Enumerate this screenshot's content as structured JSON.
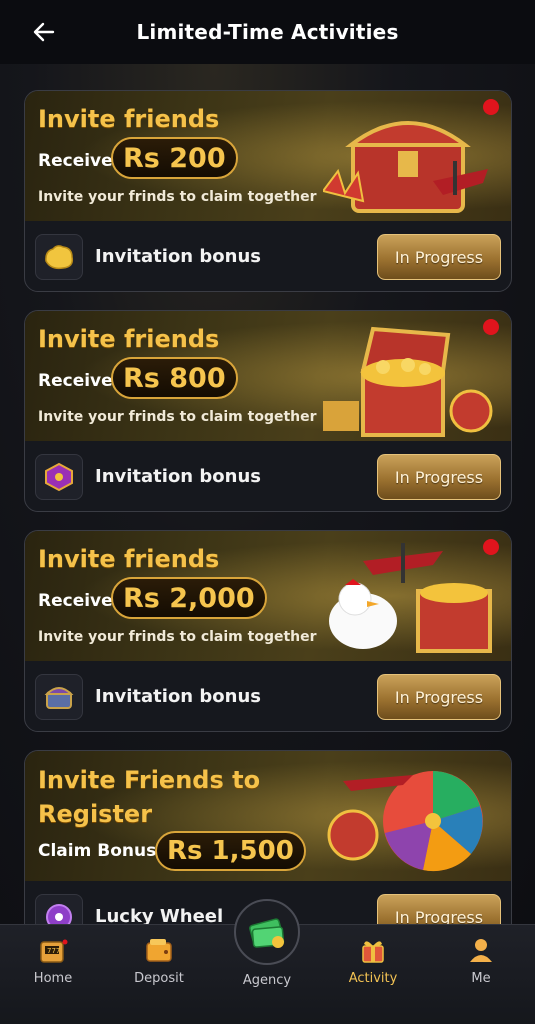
{
  "header": {
    "title": "Limited-Time Activities"
  },
  "cards": [
    {
      "title": "Invite friends",
      "receive_label": "Receive",
      "amount": "Rs 200",
      "subtitle": "Invite your frinds to claim together",
      "footer_label": "Invitation bonus",
      "button_label": "In Progress"
    },
    {
      "title": "Invite friends",
      "receive_label": "Receive",
      "amount": "Rs 800",
      "subtitle": "Invite your frinds to claim together",
      "footer_label": "Invitation bonus",
      "button_label": "In Progress"
    },
    {
      "title": "Invite friends",
      "receive_label": "Receive",
      "amount": "Rs 2,000",
      "subtitle": "Invite your frinds to claim together",
      "footer_label": "Invitation bonus",
      "button_label": "In Progress"
    },
    {
      "title_line1": "Invite Friends to",
      "title_line2": "Register",
      "claim_label": "Claim Bonus",
      "amount": "Rs 1,500",
      "footer_label": "Lucky Wheel",
      "button_label": "In Progress"
    }
  ],
  "nav": {
    "home": "Home",
    "deposit": "Deposit",
    "agency": "Agency",
    "activity": "Activity",
    "me": "Me"
  },
  "colors": {
    "accent_gold": "#f5c24a",
    "active_nav": "#f2c253",
    "notification_dot": "#e0141d"
  }
}
